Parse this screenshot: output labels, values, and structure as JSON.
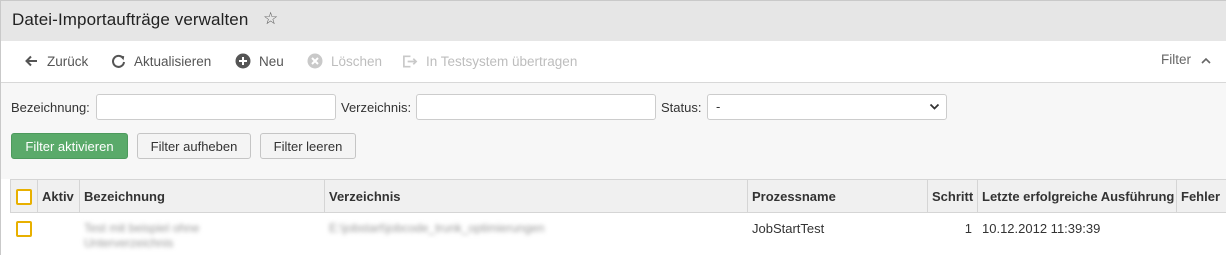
{
  "header": {
    "title": "Datei-Importaufträge verwalten",
    "favorite_icon": "star-outline-icon"
  },
  "toolbar": {
    "back_label": "Zurück",
    "refresh_label": "Aktualisieren",
    "new_label": "Neu",
    "delete_label": "Löschen",
    "transfer_label": "In Testsystem übertragen",
    "filter_label": "Filter"
  },
  "filters": {
    "bezeichnung_label": "Bezeichnung:",
    "bezeichnung_value": "",
    "verzeichnis_label": "Verzeichnis:",
    "verzeichnis_value": "",
    "status_label": "Status:",
    "status_selected": "-",
    "activate_label": "Filter aktivieren",
    "remove_label": "Filter aufheben",
    "clear_label": "Filter leeren"
  },
  "colors": {
    "accent_green": "#5aaa6a",
    "checkbox_border": "#e8b000",
    "title_bar": "#e6e6e6"
  },
  "table": {
    "columns": [
      "Aktiv",
      "Bezeichnung",
      "Verzeichnis",
      "Prozessname",
      "Schritt",
      "Letzte erfolgreiche Ausführung",
      "Fehler"
    ],
    "rows": [
      {
        "aktiv": "",
        "bezeichnung": "Test mit beispiel ohne Unterverzeichnis",
        "verzeichnis": "E:\\jobstart\\jobcode_trunk_optimierungen",
        "prozessname": "JobStartTest",
        "schritt": "1",
        "letzte_ausfuehrung": "10.12.2012 11:39:39",
        "fehler": ""
      }
    ]
  }
}
